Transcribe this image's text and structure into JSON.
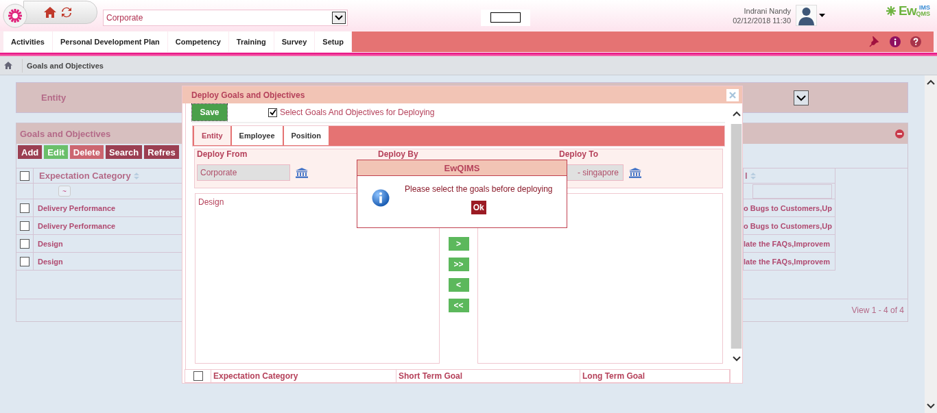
{
  "header": {
    "entity_select": "Corporate",
    "user_name": "Indrani Nandy",
    "datetime": "02/12/2018 11:30",
    "brand": {
      "main": "Ew",
      "top": "IMS",
      "bottom": "QMS"
    }
  },
  "nav_tabs": [
    {
      "label": "Activities"
    },
    {
      "label": "Personal Development Plan"
    },
    {
      "label": "Competency"
    },
    {
      "label": "Training"
    },
    {
      "label": "Survey"
    },
    {
      "label": "Setup"
    }
  ],
  "breadcrumb": "Goals and Objectives",
  "entity_filter": {
    "label": "Entity"
  },
  "goals_panel": {
    "title": "Goals and Objectives",
    "toolbar": [
      {
        "label": "Add",
        "color": "#9b3f52"
      },
      {
        "label": "Edit",
        "color": "#6abf6a"
      },
      {
        "label": "Delete",
        "color": "#cc6670"
      },
      {
        "label": "Search",
        "color": "#9b3f52"
      },
      {
        "label": "Refres",
        "color": "#9b3f52"
      }
    ],
    "columns": {
      "category": "Expectation Category",
      "kpi_partial": "I"
    },
    "filter_button": "~",
    "header_checked": false,
    "rows": [
      {
        "checked": false,
        "category": "Delivery Performance",
        "kpi": "o Bugs to Customers,Up"
      },
      {
        "checked": false,
        "category": "Delivery Performance",
        "kpi": "o Bugs to Customers,Up"
      },
      {
        "checked": false,
        "category": "Design",
        "kpi": "late the FAQs,Improvem"
      },
      {
        "checked": false,
        "category": "Design",
        "kpi": "late the FAQs,Improvem"
      }
    ],
    "pager": "View 1 - 4 of 4"
  },
  "deploy_modal": {
    "title": "Deploy Goals and Objectives",
    "save": "Save",
    "select_checkbox": {
      "label": "Select Goals And Objectives for Deploying",
      "checked": true
    },
    "tabs": [
      {
        "label": "Entity",
        "selected": true
      },
      {
        "label": "Employee",
        "selected": false
      },
      {
        "label": "Position",
        "selected": false
      }
    ],
    "deploy_from": {
      "label": "Deploy From",
      "value": "Corporate"
    },
    "deploy_by": {
      "label": "Deploy By"
    },
    "deploy_to": {
      "label": "Deploy To",
      "value": "- singapore"
    },
    "source_items": [
      "Design"
    ],
    "move_buttons": [
      ">",
      ">>",
      "<",
      "<<"
    ],
    "columns": [
      "Expectation Category",
      "Short Term Goal",
      "Long Term Goal"
    ],
    "header_checked": false
  },
  "alert": {
    "title": "EwQIMS",
    "message": "Please select the goals before deploying",
    "ok": "Ok"
  }
}
